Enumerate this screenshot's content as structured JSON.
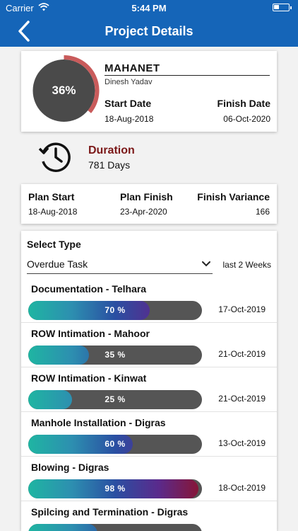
{
  "status": {
    "carrier": "Carrier",
    "time": "5:44 PM"
  },
  "nav": {
    "title": "Project Details"
  },
  "project": {
    "progress_text": "36%",
    "progress": 0.36,
    "name": "MAHANET",
    "owner": "Dinesh Yadav",
    "start_label": "Start Date",
    "start_date": "18-Aug-2018",
    "finish_label": "Finish Date",
    "finish_date": "06-Oct-2020"
  },
  "duration": {
    "label": "Duration",
    "value": "781 Days"
  },
  "plan": {
    "start_label": "Plan Start",
    "start_value": "18-Aug-2018",
    "finish_label": "Plan Finish",
    "finish_value": "23-Apr-2020",
    "variance_label": "Finish Variance",
    "variance_value": "166"
  },
  "select": {
    "label": "Select Type",
    "value": "Overdue Task",
    "period": "last 2 Weeks"
  },
  "tasks": [
    {
      "title": "Documentation - Telhara",
      "percent": 70,
      "percent_text": "70 %",
      "date": "17-Oct-2019"
    },
    {
      "title": "ROW Intimation - Mahoor",
      "percent": 35,
      "percent_text": "35 %",
      "date": "21-Oct-2019"
    },
    {
      "title": "ROW Intimation - Kinwat",
      "percent": 25,
      "percent_text": "25 %",
      "date": "21-Oct-2019"
    },
    {
      "title": "Manhole Installation - Digras",
      "percent": 60,
      "percent_text": "60 %",
      "date": "13-Oct-2019"
    },
    {
      "title": "Blowing - Digras",
      "percent": 98,
      "percent_text": "98 %",
      "date": "18-Oct-2019"
    },
    {
      "title": "Spilcing and Termination - Digras",
      "percent": 40,
      "percent_text": "",
      "date": ""
    }
  ],
  "colors": {
    "header": "#1565b8",
    "ring_track": "#4a4a4a",
    "ring_progress": "#c95b5b",
    "duration_label": "#7b1818"
  },
  "icons": {
    "back": "chevron-left-icon",
    "clock": "history-clock-icon",
    "dropdown": "chevron-down-icon",
    "wifi": "wifi-icon",
    "battery": "battery-icon"
  }
}
